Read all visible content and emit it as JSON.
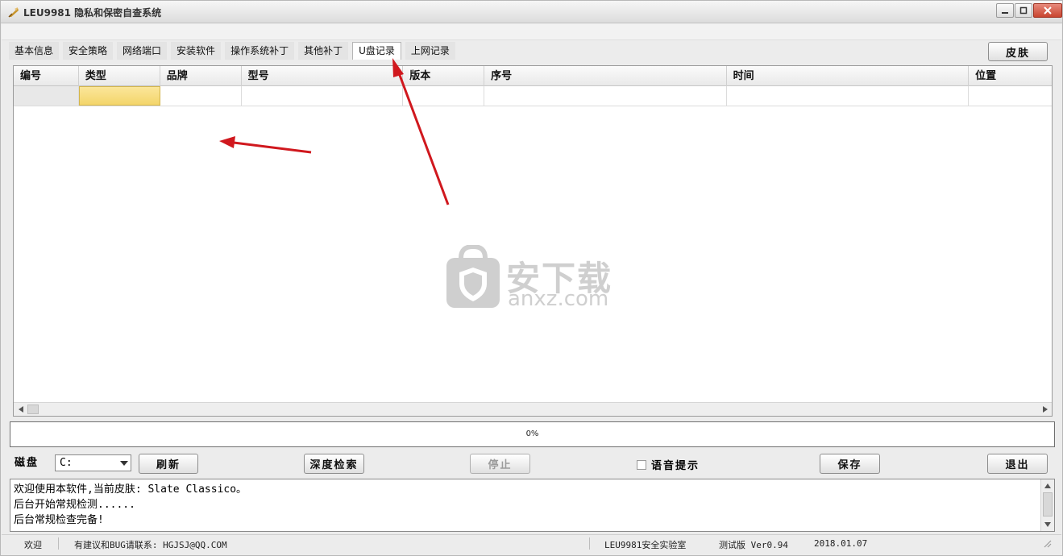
{
  "window": {
    "title": "LEU9981 隐私和保密自查系统"
  },
  "tabs": [
    {
      "label": "基本信息"
    },
    {
      "label": "安全策略"
    },
    {
      "label": "网络端口"
    },
    {
      "label": "安装软件"
    },
    {
      "label": "操作系统补丁"
    },
    {
      "label": "其他补丁"
    },
    {
      "label": "U盘记录",
      "active": true
    },
    {
      "label": "上网记录"
    }
  ],
  "skin_button": "皮肤",
  "grid": {
    "columns": [
      "编号",
      "类型",
      "品牌",
      "型号",
      "版本",
      "序号",
      "时间",
      "位置"
    ]
  },
  "watermark": {
    "cn": "安下载",
    "en": "anxz.com"
  },
  "progress": {
    "value": 0,
    "label": "0%"
  },
  "controls": {
    "disk_label": "磁盘",
    "disk_value": "C:",
    "refresh": "刷新",
    "deep_search": "深度检索",
    "stop": "停止",
    "voice_prompt": "语音提示",
    "save": "保存",
    "exit": "退出"
  },
  "log": [
    "欢迎使用本软件,当前皮肤: Slate Classico。",
    "后台开始常规检测......",
    "后台常规检查完备!"
  ],
  "statusbar": {
    "welcome": "欢迎",
    "contact": "有建议和BUG请联系: HGJSJ@QQ.COM",
    "lab": "LEU9981安全实验室",
    "version": "测试版 Ver0.94",
    "date": "2018.01.07"
  },
  "colors": {
    "selected_cell": "#f3d56a",
    "annotation_arrow": "#d0181e",
    "close_button": "#c84530"
  }
}
